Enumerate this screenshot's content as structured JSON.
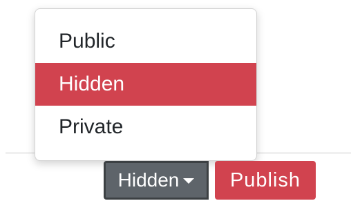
{
  "visibility_menu": {
    "options": [
      {
        "label": "Public"
      },
      {
        "label": "Hidden"
      },
      {
        "label": "Private"
      }
    ],
    "selected": "Hidden"
  },
  "toolbar": {
    "visibility_button_label": "Hidden",
    "publish_label": "Publish"
  },
  "colors": {
    "accent": "#d1434f",
    "toggle_bg": "#5e646a"
  }
}
